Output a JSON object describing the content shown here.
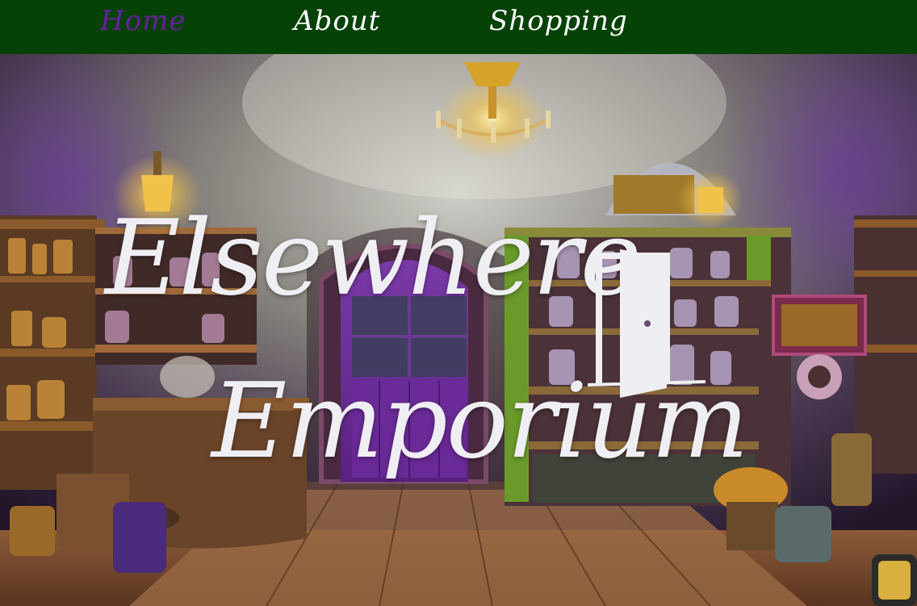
{
  "nav": {
    "items": [
      {
        "label": "Home",
        "active": true
      },
      {
        "label": "About",
        "active": false
      },
      {
        "label": "Shopping",
        "active": false
      }
    ],
    "background_color": "#064206",
    "active_color": "#6a1fa0",
    "text_color": "#ffffff"
  },
  "hero": {
    "title_line1": "Elsewhere",
    "title_line2": "Emporium",
    "title_color": "#efeef3",
    "logo_icon": "open-door-icon",
    "background_scene": "magic-shop-interior-illustration"
  }
}
